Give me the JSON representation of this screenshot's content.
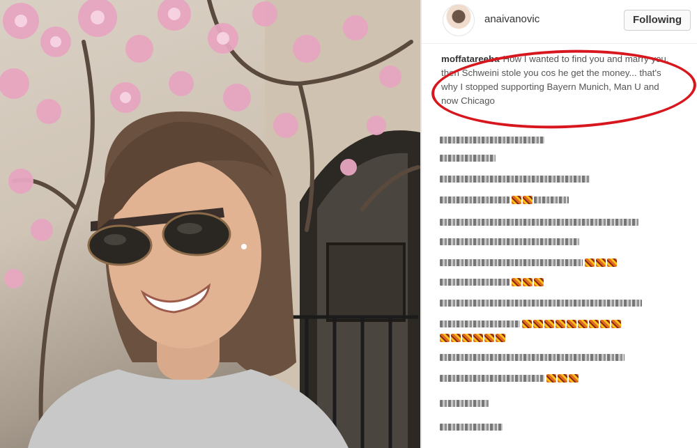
{
  "post": {
    "username": "anaivanovic",
    "follow_button": "Following"
  },
  "comment": {
    "user": "moffatareeba",
    "text": "How I wanted to find you and marry you, then Schweini stole you cos he get the money... that's why I stopped supporting Bayern Munich, Man U and now Chicago"
  },
  "censored_comments_visible": 14,
  "colors": {
    "highlight": "#d8161e",
    "blossom": "#e7a6c0",
    "sweater": "#c8c8c8"
  }
}
